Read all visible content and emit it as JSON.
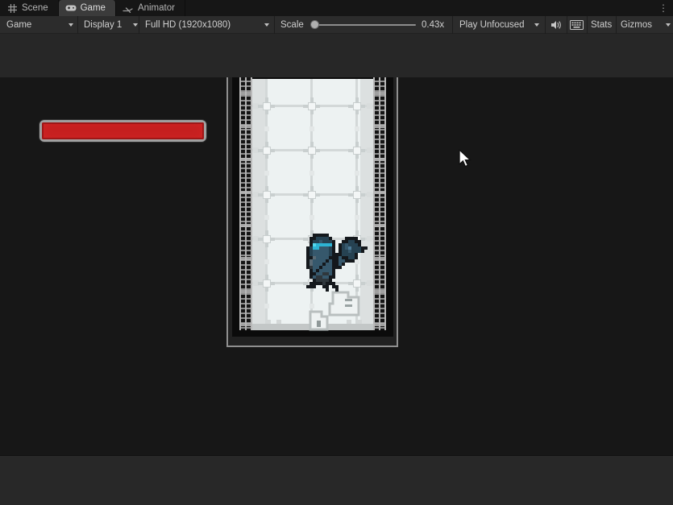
{
  "tabs": {
    "scene": {
      "label": "Scene"
    },
    "game": {
      "label": "Game"
    },
    "animator": {
      "label": "Animator"
    },
    "kebab": "⋮"
  },
  "toolbar": {
    "game_dropdown": "Game",
    "display_dropdown": "Display 1",
    "resolution_dropdown": "Full HD (1920x1080)",
    "scale_label": "Scale",
    "scale_value": "0.43x",
    "play_unfocused_label": "Play Unfocused",
    "stats_label": "Stats",
    "gizmos_label": "Gizmos",
    "icons": [
      "mute-audio-icon",
      "keyboard-shortcuts-icon"
    ]
  },
  "game_view": {
    "health_bar": {
      "fill_pct": 100,
      "fill_color": "#c52020",
      "border_color": "#a0a0a0"
    },
    "level": {
      "colors": {
        "floor": "#edf2f2",
        "light_column": "#dce0e0",
        "grid_line": "#d3d8d8",
        "plus": "#c9cfcf",
        "plus_center": "#f3f6f6",
        "cap": "#d8dcdc",
        "mid_square": "#e3e7e7",
        "nub": "#d4d8d8",
        "bottom_bar": "#c3c7c7",
        "wall": "#0b0b0b",
        "frame": "#8f8f8f",
        "strip_bg": "#212121"
      },
      "grid": {
        "vlines": [
          16,
          72,
          128
        ],
        "hlines": [
          32,
          87,
          142,
          197,
          252
        ],
        "mid_squares": [
          59,
          114,
          169,
          224,
          279
        ],
        "nubs": [
          17,
          30,
          75,
          117,
          130
        ]
      }
    },
    "knight_sprite": {
      "pixel_size": 4,
      "palette": {
        "K": "#14181c",
        "D": "#264252",
        "B": "#36586c",
        "L": "#4d7b97",
        "C": "#2db4d4",
        "A": "#54d6ec",
        "G": "#2f373c",
        "S": "#5a6a74"
      },
      "rows": [
        "..KKKKK............",
        ".KKDDDDK....KKKK...",
        ".KDDBDDDK..KKDDKK..",
        ".KACCCCCK.KDBDDDK..",
        "KDCCBBBDK.KDBLDDDKK",
        "KDBBBBBDK.KDDBDDDK.",
        "KDBBBBBDKKKDDDDK...",
        "KKSBBBBKKKBKKDDK...",
        "KSBBBBKBKKBBKKK....",
        "KSBBBKBBKKBK.......",
        "KGBBKBBBKKK........",
        ".KBKBBBBK..........",
        ".KKBBGGBK..........",
        ".KBGGBBKK..........",
        "..KGGGGK...........",
        ".KKKKGKKK..........",
        "KKK..KK.KK.........",
        "......K..K........."
      ]
    }
  }
}
